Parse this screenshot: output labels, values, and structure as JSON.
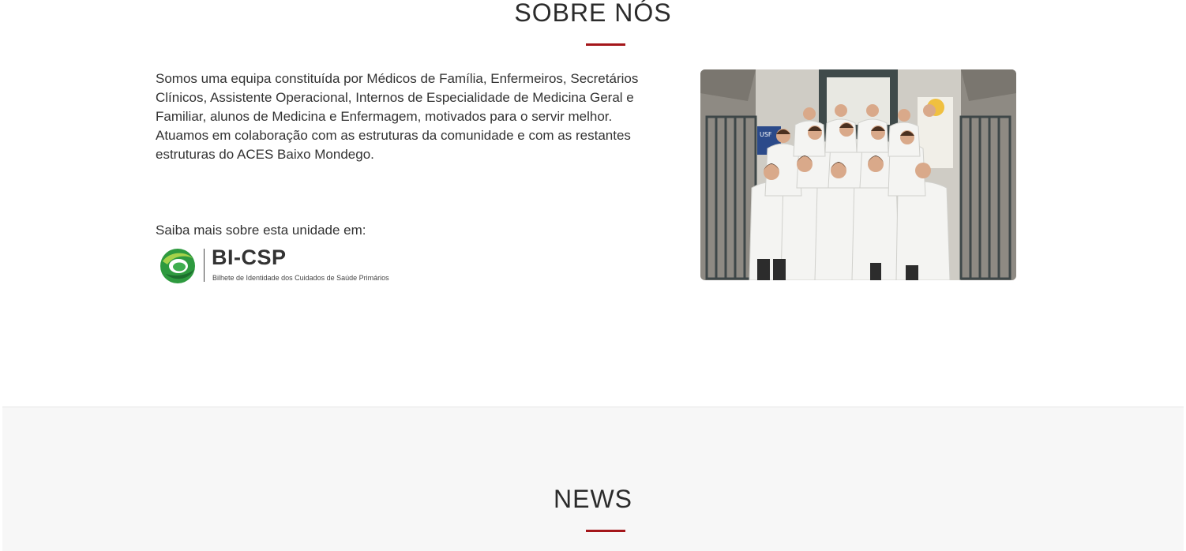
{
  "about": {
    "title": "SOBRE NÓS",
    "text": "Somos uma equipa constituída por Médicos de Família, Enfermeiros, Secretários Clínicos, Assistente Operacional,  Internos de Especialidade de Medicina Geral e Familiar, alunos de Medicina e Enfermagem, motivados para o servir melhor. Atuamos em colaboração com as estruturas da comunidade e com as restantes estruturas do ACES Baixo Mondego.",
    "more_label": "Saiba mais sobre esta unidade em:",
    "bicsp": {
      "name": "BI-CSP",
      "tagline": "Bilhete de Identidade dos Cuidados de Saúde Primários"
    },
    "photo": {
      "sign_text": "USF"
    }
  },
  "news": {
    "title": "NEWS"
  },
  "colors": {
    "accent": "#a4161a",
    "news_background": "#f7f7f7"
  }
}
